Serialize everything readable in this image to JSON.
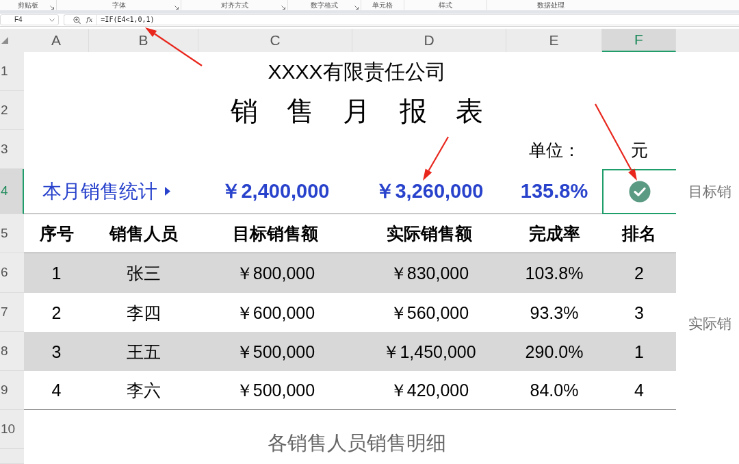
{
  "ribbon": {
    "groups": [
      {
        "label": "剪贴板",
        "launcher": true
      },
      {
        "label": "字体",
        "launcher": true
      },
      {
        "label": "对齐方式",
        "launcher": true
      },
      {
        "label": "数字格式",
        "launcher": true
      },
      {
        "label": "单元格",
        "launcher": false
      },
      {
        "label": "样式",
        "launcher": false
      },
      {
        "label": "数据处理",
        "launcher": false
      }
    ]
  },
  "formula_bar": {
    "name_box": "F4",
    "function_label": "fx",
    "formula": "=IF(E4<1,0,1)"
  },
  "column_headers": [
    {
      "label": "A",
      "selected": false
    },
    {
      "label": "B",
      "selected": false
    },
    {
      "label": "C",
      "selected": false
    },
    {
      "label": "D",
      "selected": false
    },
    {
      "label": "E",
      "selected": false
    },
    {
      "label": "F",
      "selected": true
    }
  ],
  "row_headers": [
    {
      "label": "1",
      "selected": false
    },
    {
      "label": "2",
      "selected": false
    },
    {
      "label": "3",
      "selected": false
    },
    {
      "label": "4",
      "selected": true
    },
    {
      "label": "5",
      "selected": false
    },
    {
      "label": "6",
      "selected": false
    },
    {
      "label": "7",
      "selected": false
    },
    {
      "label": "8",
      "selected": false
    },
    {
      "label": "9",
      "selected": false
    },
    {
      "label": "10",
      "selected": false
    }
  ],
  "sheet": {
    "company": "XXXX有限责任公司",
    "title": "销 售 月 报 表",
    "unit_label": "单位：",
    "unit": "元",
    "summary": {
      "label": "本月销售统计",
      "values": [
        "￥2,400,000",
        "￥3,260,000",
        "135.8%"
      ],
      "status": {
        "target_met": true,
        "selected": true
      }
    },
    "table": {
      "columns": [
        "序号",
        "销售人员",
        "目标销售额",
        "实际销售额",
        "完成率",
        "排名"
      ],
      "rows": [
        {
          "shaded": true,
          "cells": [
            "1",
            "张三",
            "￥800,000",
            "￥830,000",
            "103.8%",
            "2"
          ]
        },
        {
          "shaded": false,
          "cells": [
            "2",
            "李四",
            "￥600,000",
            "￥560,000",
            "93.3%",
            "3"
          ]
        },
        {
          "shaded": true,
          "cells": [
            "3",
            "王五",
            "￥500,000",
            "￥1,450,000",
            "290.0%",
            "1"
          ]
        },
        {
          "shaded": false,
          "cells": [
            "4",
            "李六",
            "￥500,000",
            "￥420,000",
            "84.0%",
            "4"
          ]
        }
      ]
    },
    "chart_title": "各销售人员销售明细",
    "side_labels": [
      "目标销",
      "实际销"
    ]
  }
}
